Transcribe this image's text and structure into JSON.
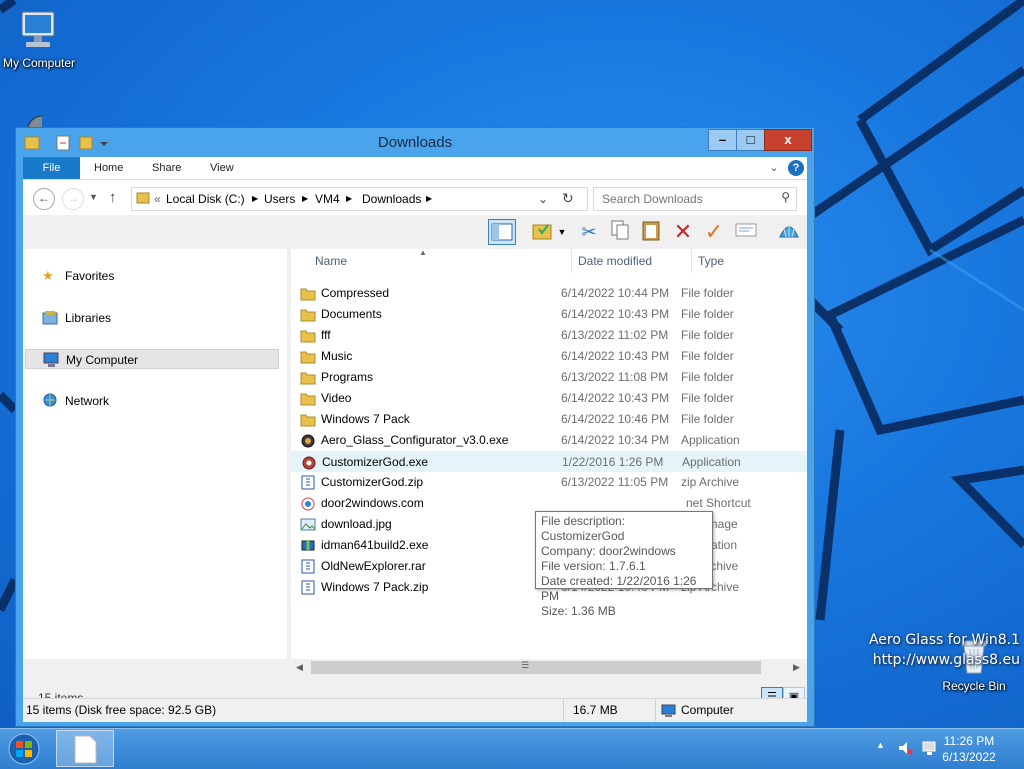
{
  "desktop": {
    "icons": {
      "my_computer": "My Computer",
      "recycle_bin": "Recycle Bin"
    },
    "watermark": {
      "line1": "Aero Glass for Win8.1",
      "line2": "http://www.glass8.eu"
    }
  },
  "window": {
    "title": "Downloads",
    "caption_buttons": {
      "minimize": "–",
      "maximize": "□",
      "close": "x"
    }
  },
  "ribbon": {
    "tabs": [
      "File",
      "Home",
      "Share",
      "View"
    ]
  },
  "address": {
    "breadcrumbs": [
      "Local Disk (C:)",
      "Users",
      "VM4",
      "Downloads"
    ],
    "overflow": "«",
    "search_placeholder": "Search Downloads"
  },
  "navpane": {
    "items": [
      "Favorites",
      "Libraries",
      "My Computer",
      "Network"
    ],
    "selected": "My Computer"
  },
  "filelist": {
    "columns": [
      "Name",
      "Date modified",
      "Type",
      "S"
    ],
    "rows": [
      {
        "name": "Compressed",
        "date": "6/14/2022 10:44 PM",
        "type": "File folder",
        "icon": "folder-icon"
      },
      {
        "name": "Documents",
        "date": "6/14/2022 10:43 PM",
        "type": "File folder",
        "icon": "folder-icon"
      },
      {
        "name": "fff",
        "date": "6/13/2022 11:02 PM",
        "type": "File folder",
        "icon": "folder-icon"
      },
      {
        "name": "Music",
        "date": "6/14/2022 10:43 PM",
        "type": "File folder",
        "icon": "folder-icon"
      },
      {
        "name": "Programs",
        "date": "6/13/2022 11:08 PM",
        "type": "File folder",
        "icon": "folder-icon"
      },
      {
        "name": "Video",
        "date": "6/14/2022 10:43 PM",
        "type": "File folder",
        "icon": "folder-icon"
      },
      {
        "name": "Windows 7 Pack",
        "date": "6/14/2022 10:46 PM",
        "type": "File folder",
        "icon": "folder-icon"
      },
      {
        "name": "Aero_Glass_Configurator_v3.0.exe",
        "date": "6/14/2022 10:34 PM",
        "type": "Application",
        "icon": "app-icon"
      },
      {
        "name": "CustomizerGod.exe",
        "date": "1/22/2016 1:26 PM",
        "type": "Application",
        "icon": "gear-app-icon"
      },
      {
        "name": "CustomizerGod.zip",
        "date": "6/13/2022 11:05 PM",
        "type": "zip Archive",
        "icon": "zip-icon"
      },
      {
        "name": "door2windows.com",
        "date": "",
        "type": "net Shortcut",
        "icon": "web-shortcut-icon"
      },
      {
        "name": "download.jpg",
        "date": "",
        "type": "image",
        "icon": "image-icon"
      },
      {
        "name": "idman641build2.exe",
        "date": "",
        "type": "cation",
        "icon": "installer-icon"
      },
      {
        "name": "OldNewExplorer.rar",
        "date": "6/13/2022 11:02 PM",
        "type": "rar Archive",
        "icon": "rar-icon"
      },
      {
        "name": "Windows 7 Pack.zip",
        "date": "6/14/2022 10:40 PM",
        "type": "zip Archive",
        "icon": "zip-icon"
      }
    ]
  },
  "tooltip": {
    "lines": [
      "File description: CustomizerGod",
      "Company: door2windows",
      "File version: 1.7.6.1",
      "Date created: 1/22/2016 1:26 PM",
      "Size: 1.36 MB"
    ]
  },
  "footer": {
    "item_count": "15 items"
  },
  "statusbar": {
    "summary": "15 items (Disk free space: 92.5 GB)",
    "size": "16.7 MB",
    "location": "Computer"
  },
  "taskbar": {
    "time": "11:26 PM",
    "date": "6/13/2022"
  }
}
